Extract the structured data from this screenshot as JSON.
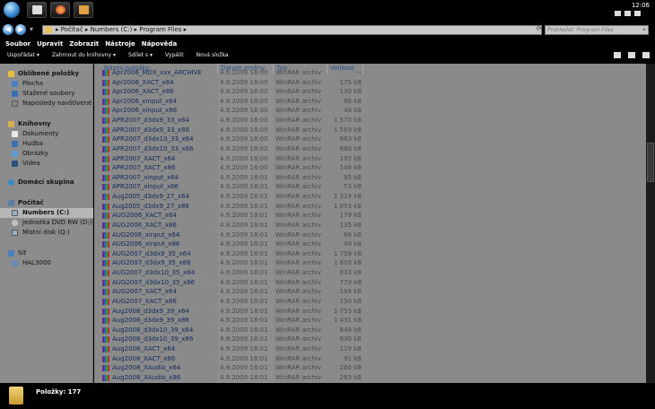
{
  "taskbar": {
    "clock_time": "12:06",
    "clock_sub": "■ ■ ■"
  },
  "address": {
    "crumbs": "▸ Počítač ▸ Numbers (C:) ▸ Program Files ▸",
    "search_placeholder": "Prohledat: Program Files"
  },
  "menu": [
    "Soubor",
    "Upravit",
    "Zobrazit",
    "Nástroje",
    "Nápověda"
  ],
  "commands": [
    "Uspořádat ▾",
    "Zahrnout do knihovny ▾",
    "Sdílet s ▾",
    "Vypálit",
    "Nová složka"
  ],
  "nav": {
    "favorites": "Oblíbené položky",
    "desktop": "Plocha",
    "downloads": "Stažené soubory",
    "recent": "Naposledy navštívené",
    "libraries": "Knihovny",
    "documents": "Dokumenty",
    "music": "Hudba",
    "pictures": "Obrázky",
    "videos": "Videa",
    "homegroup": "Domácí skupina",
    "computer": "Počítač",
    "drive_c": "Numbers (C:)",
    "drive_d": "Jednotka DVD RW (D:) N",
    "drive_q": "Místní disk (Q:)",
    "network": "Síť",
    "hal": "HAL3000"
  },
  "columns": {
    "name": "Název položky",
    "date": "Datum změny",
    "type": "Typ",
    "size": "Velikost"
  },
  "files": [
    {
      "name": "Apr2006_MDX_xxx_ARCHIVE",
      "date": "4.9.2009 18:00",
      "type": "WinRAR archiv",
      "size": "---"
    },
    {
      "name": "Apr2006_XACT_x64",
      "date": "4.9.2009 18:00",
      "type": "WinRAR archiv",
      "size": "175 kB"
    },
    {
      "name": "Apr2006_XACT_x86",
      "date": "4.9.2009 18:00",
      "type": "WinRAR archiv",
      "size": "130 kB"
    },
    {
      "name": "Apr2006_xinput_x64",
      "date": "4.9.2009 18:00",
      "type": "WinRAR archiv",
      "size": "86 kB"
    },
    {
      "name": "Apr2006_xinput_x86",
      "date": "4.9.2009 18:00",
      "type": "WinRAR archiv",
      "size": "48 kB"
    },
    {
      "name": "APR2007_d3dx9_33_x64",
      "date": "4.9.2009 18:00",
      "type": "WinRAR archiv",
      "size": "1 570 kB"
    },
    {
      "name": "APR2007_d3dx9_33_x86",
      "date": "4.9.2009 18:00",
      "type": "WinRAR archiv",
      "size": "1 569 kB"
    },
    {
      "name": "APR2007_d3dx10_33_x64",
      "date": "4.9.2009 18:00",
      "type": "WinRAR archiv",
      "size": "683 kB"
    },
    {
      "name": "APR2007_d3dx10_33_x86",
      "date": "4.9.2009 18:00",
      "type": "WinRAR archiv",
      "size": "680 kB"
    },
    {
      "name": "APR2007_XACT_x64",
      "date": "4.9.2009 18:00",
      "type": "WinRAR archiv",
      "size": "192 kB"
    },
    {
      "name": "APR2007_XACT_x86",
      "date": "4.9.2009 18:00",
      "type": "WinRAR archiv",
      "size": "148 kB"
    },
    {
      "name": "APR2007_xinput_x64",
      "date": "4.9.2009 18:01",
      "type": "WinRAR archiv",
      "size": "95 kB"
    },
    {
      "name": "APR2007_xinput_x86",
      "date": "4.9.2009 18:01",
      "type": "WinRAR archiv",
      "size": "53 kB"
    },
    {
      "name": "Aug2005_d3dx9_27_x64",
      "date": "4.9.2009 18:01",
      "type": "WinRAR archiv",
      "size": "1 319 kB"
    },
    {
      "name": "Aug2005_d3dx9_27_x86",
      "date": "4.9.2009 18:01",
      "type": "WinRAR archiv",
      "size": "1 053 kB"
    },
    {
      "name": "AUG2006_XACT_x64",
      "date": "4.9.2009 18:01",
      "type": "WinRAR archiv",
      "size": "179 kB"
    },
    {
      "name": "AUG2006_XACT_x86",
      "date": "4.9.2009 18:01",
      "type": "WinRAR archiv",
      "size": "135 kB"
    },
    {
      "name": "AUG2006_xinput_x64",
      "date": "4.9.2009 18:01",
      "type": "WinRAR archiv",
      "size": "86 kB"
    },
    {
      "name": "AUG2006_xinput_x86",
      "date": "4.9.2009 18:01",
      "type": "WinRAR archiv",
      "size": "49 kB"
    },
    {
      "name": "AUG2007_d3dx9_35_x64",
      "date": "4.9.2009 18:01",
      "type": "WinRAR archiv",
      "size": "1 758 kB"
    },
    {
      "name": "AUG2007_d3dx9_35_x86",
      "date": "4.9.2009 18:01",
      "type": "WinRAR archiv",
      "size": "1 609 kB"
    },
    {
      "name": "AUG2007_d3dx10_35_x64",
      "date": "4.9.2009 18:01",
      "type": "WinRAR archiv",
      "size": "833 kB"
    },
    {
      "name": "AUG2007_d3dx10_35_x86",
      "date": "4.9.2009 18:01",
      "type": "WinRAR archiv",
      "size": "779 kB"
    },
    {
      "name": "AUG2007_XACT_x64",
      "date": "4.9.2009 18:01",
      "type": "WinRAR archiv",
      "size": "194 kB"
    },
    {
      "name": "AUG2007_XACT_x86",
      "date": "4.9.2009 18:01",
      "type": "WinRAR archiv",
      "size": "150 kB"
    },
    {
      "name": "Aug2008_d3dx9_39_x64",
      "date": "4.9.2009 18:01",
      "type": "WinRAR archiv",
      "size": "1 753 kB"
    },
    {
      "name": "Aug2008_d3dx9_39_x86",
      "date": "4.9.2009 18:01",
      "type": "WinRAR archiv",
      "size": "1 431 kB"
    },
    {
      "name": "Aug2008_d3dx10_39_x64",
      "date": "4.9.2009 18:01",
      "type": "WinRAR archiv",
      "size": "848 kB"
    },
    {
      "name": "Aug2008_d3dx10_39_x86",
      "date": "4.9.2009 18:01",
      "type": "WinRAR archiv",
      "size": "830 kB"
    },
    {
      "name": "Aug2008_XACT_x64",
      "date": "4.9.2009 18:01",
      "type": "WinRAR archiv",
      "size": "119 kB"
    },
    {
      "name": "Aug2008_XACT_x86",
      "date": "4.9.2009 18:01",
      "type": "WinRAR archiv",
      "size": "91 kB"
    },
    {
      "name": "Aug2008_XAudio_x64",
      "date": "4.9.2009 18:01",
      "type": "WinRAR archiv",
      "size": "266 kB"
    },
    {
      "name": "Aug2008_XAudio_x86",
      "date": "4.9.2009 18:01",
      "type": "WinRAR archiv",
      "size": "265 kB"
    }
  ],
  "status": {
    "items_count": "Položky: 177"
  },
  "colors": {
    "list_bg": "#8a8a8a",
    "nav_bg": "#8c8c8c",
    "header_text": "#2a4f86",
    "chrome": "#000000"
  }
}
